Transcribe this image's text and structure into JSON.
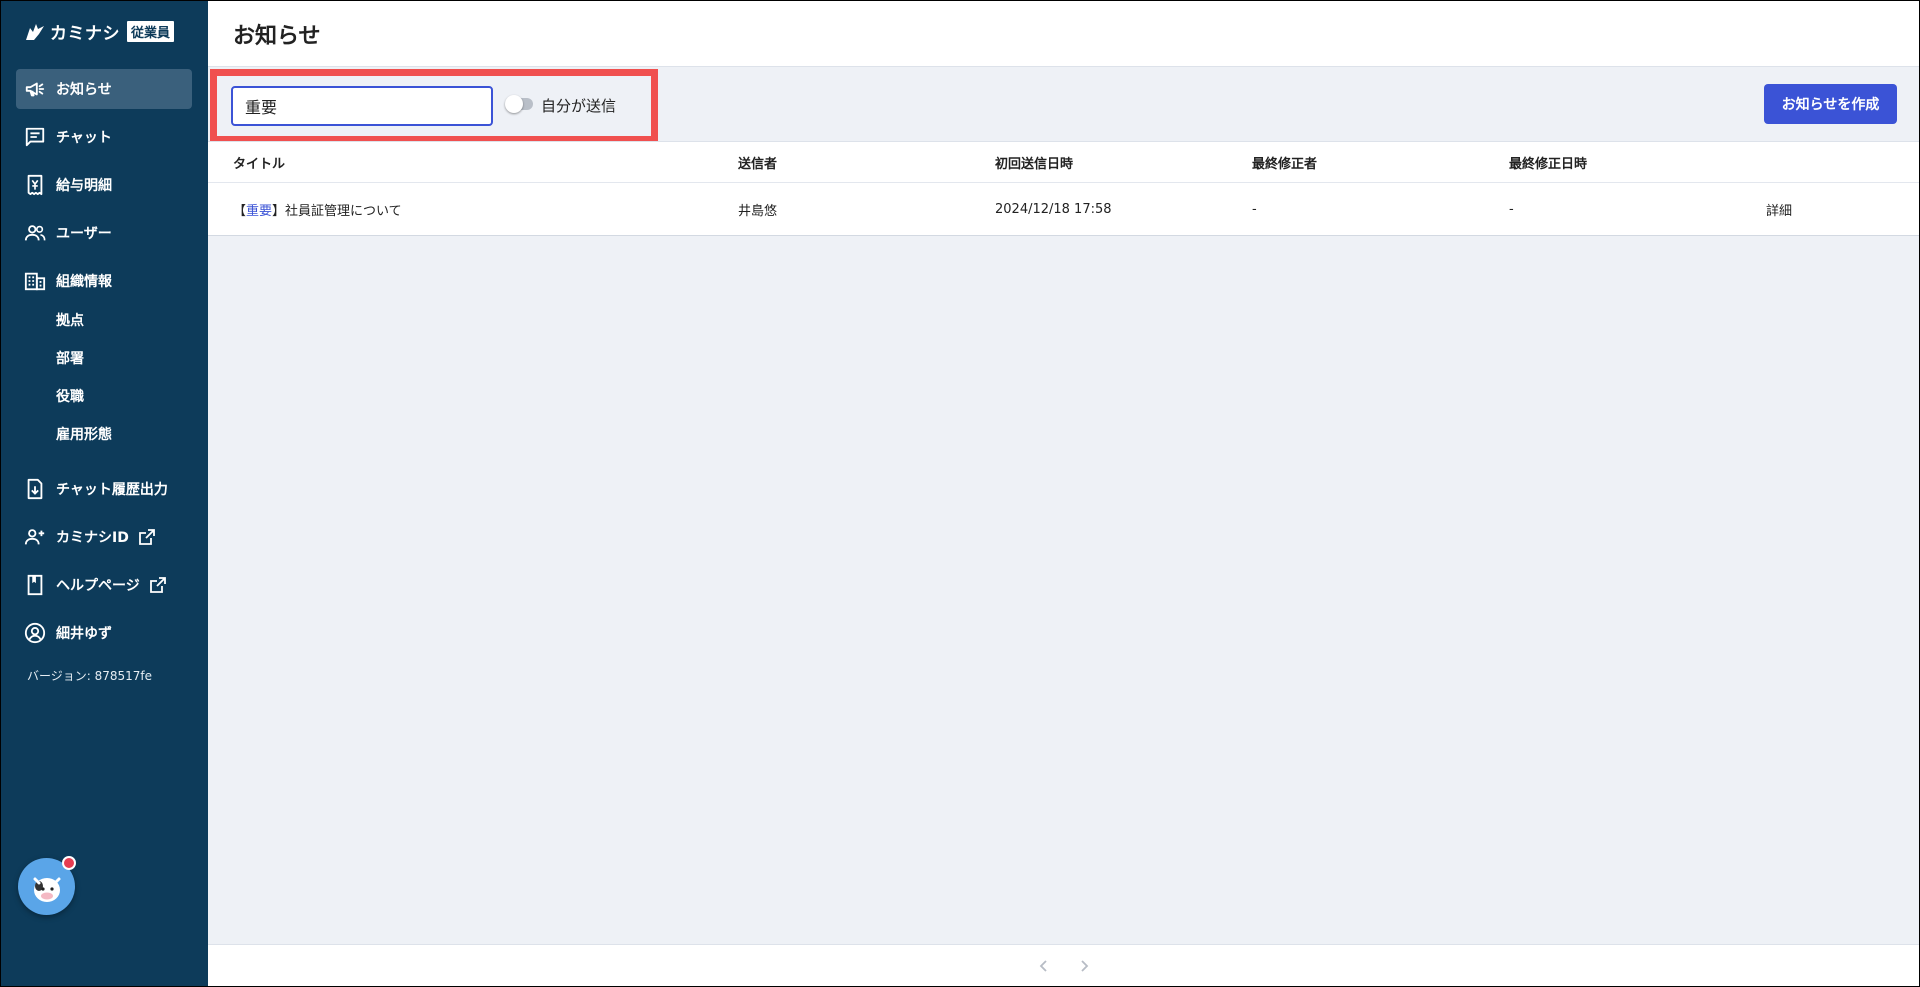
{
  "app": {
    "logo_text": "カミナシ",
    "logo_badge": "従業員"
  },
  "sidebar": {
    "items": [
      {
        "label": "お知らせ",
        "icon": "megaphone-icon",
        "active": true
      },
      {
        "label": "チャット",
        "icon": "chat-icon"
      },
      {
        "label": "給与明細",
        "icon": "payslip-icon"
      },
      {
        "label": "ユーザー",
        "icon": "users-icon"
      },
      {
        "label": "組織情報",
        "icon": "building-icon"
      }
    ],
    "org_sub_items": [
      "拠点",
      "部署",
      "役職",
      "雇用形態"
    ],
    "bottom_items": [
      {
        "label": "チャット履歴出力",
        "icon": "file-download-icon"
      },
      {
        "label": "カミナシID",
        "icon": "person-add-icon",
        "external": true
      },
      {
        "label": "ヘルプページ",
        "icon": "book-icon",
        "external": true
      }
    ],
    "user_name": "細井ゆず",
    "version": "バージョン: 878517fe"
  },
  "page": {
    "title": "お知らせ"
  },
  "filters": {
    "search_value": "重要",
    "toggle_label": "自分が送信",
    "toggle_on": false
  },
  "actions": {
    "create_label": "お知らせを作成"
  },
  "table": {
    "columns": [
      "タイトル",
      "送信者",
      "初回送信日時",
      "最終修正者",
      "最終修正日時"
    ],
    "rows": [
      {
        "title_prefix": "【",
        "title_highlight": "重要",
        "title_suffix": "】社員証管理について",
        "sender": "井島悠",
        "first_sent": "2024/12/18 17:58",
        "last_editor": "-",
        "last_edited": "-",
        "detail_label": "詳細"
      }
    ]
  },
  "colors": {
    "sidebar_bg": "#0d3b5a",
    "accent": "#3b53d6",
    "highlight_border": "#f0504f"
  }
}
